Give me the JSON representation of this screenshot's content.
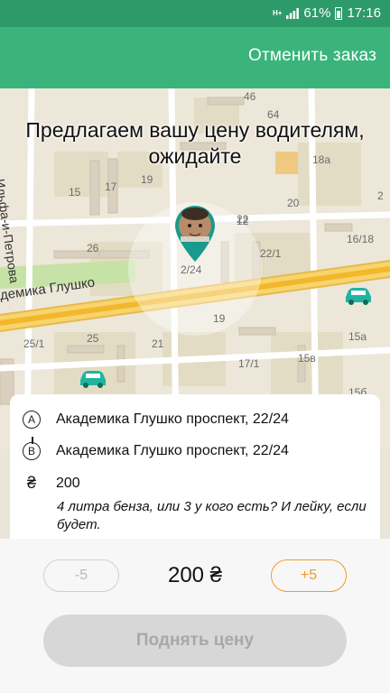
{
  "status_bar": {
    "network_type": "H+",
    "battery": "61%",
    "time": "17:16"
  },
  "toolbar": {
    "cancel_label": "Отменить заказ"
  },
  "map": {
    "headline": "Предлагаем вашу цену водителям, ожидайте",
    "street_main": "проспект Академика Глушко",
    "street_side": "Ильфа-и-Петрова",
    "house_numbers": [
      "46",
      "64",
      "15",
      "17",
      "19",
      "18a",
      "26",
      "20",
      "22",
      "16/18",
      "2/24",
      "22/1",
      "25/1",
      "25",
      "21",
      "19",
      "17/1",
      "15a",
      "15в",
      "15б",
      "2",
      "12"
    ]
  },
  "order": {
    "point_a_badge": "A",
    "point_a": "Академика Глушко проспект, 22/24",
    "point_b_badge": "B",
    "point_b": "Академика Глушко проспект, 22/24",
    "currency_icon": "₴",
    "price": "200",
    "comment": "4 литра бенза, или 3 у кого есть? И лейку, если будет."
  },
  "price_panel": {
    "minus_label": "-5",
    "current_price": "200 ₴",
    "plus_label": "+5",
    "raise_label": "Поднять цену"
  }
}
